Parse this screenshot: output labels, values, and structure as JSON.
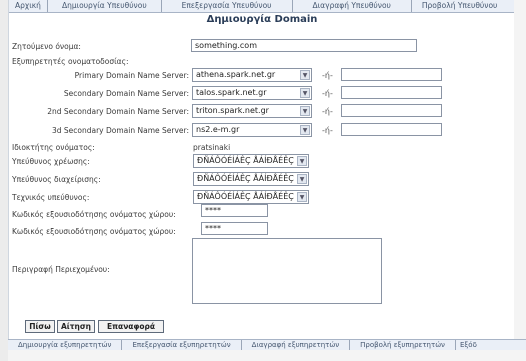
{
  "nav": {
    "items": [
      "Αρχική",
      "Δημιουργία Υπευθύνου",
      "Επεξεργασία Υπευθύνου",
      "Διαγραφή Υπευθύνου",
      "Προβολή Υπευθύνου"
    ]
  },
  "page": {
    "title": "Δημιουργία Domain"
  },
  "form": {
    "requested_name_label": "Ζητούμενο όνομα:",
    "requested_name_value": "something.com",
    "servers_heading": "Εξυπηρετητές ονοματοδοσίας:",
    "servers": [
      {
        "label": "Primary Domain Name Server:",
        "value": "athena.spark.net.gr",
        "sep": "-ή-"
      },
      {
        "label": "Secondary Domain Name Server:",
        "value": "talos.spark.net.gr",
        "sep": "-ή-"
      },
      {
        "label": "2nd Secondary Domain Name Server:",
        "value": "triton.spark.net.gr",
        "sep": "-ή-"
      },
      {
        "label": "3d Secondary Domain Name Server:",
        "value": "ns2.e-m.gr",
        "sep": "-ή-"
      }
    ],
    "owner_label": "Ιδιοκτήτης ονόματος:",
    "owner_value": "pratsinaki",
    "billing_label": "Υπεύθυνος χρέωσης:",
    "billing_value": "ÐÑÁÔÓÉÍÁÊÇ ÅÁÍÐÅÉÊÇ",
    "admin_label": "Υπεύθυνος διαχείρισης:",
    "admin_value": "ÐÑÁÔÓÉÍÁÊÇ ÅÁÍÐÅÉÊÇ",
    "tech_label": "Τεχνικός υπεύθυνος:",
    "tech_value": "ÐÑÁÔÓÉÍÁÊÇ ÅÁÍÐÅÉÊÇ",
    "auth_code_label": "Κωδικός εξουσιοδότησης ονόματος χώρου:",
    "auth_code_value": "****",
    "auth_code2_label": "Κωδικός εξουσιοδότησης ονόματος χώρου:",
    "auth_code2_value": "****",
    "description_label": "Περιγραφή Περιεχομένου:"
  },
  "buttons": {
    "back": "Πίσω",
    "request": "Αίτηση",
    "reset": "Επαναφορά"
  },
  "bottom_nav": {
    "items": [
      "Δημιουργία εξυπηρετητών",
      "Επεξεργασία εξυπηρετητών",
      "Διαγραφή εξυπηρετητών",
      "Προβολή εξυπηρετητών",
      "Εξόδ"
    ]
  }
}
